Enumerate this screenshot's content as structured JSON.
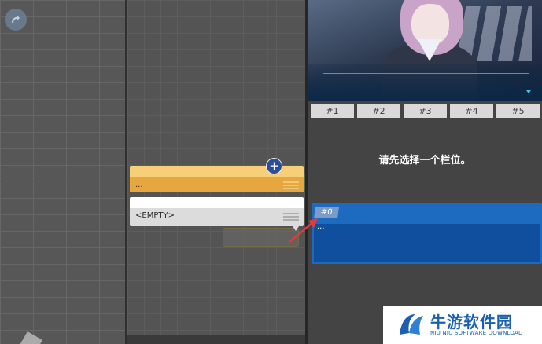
{
  "left_panel": {
    "redo_icon": "redo-arrow-icon"
  },
  "nodes": [
    {
      "text": "...",
      "color": "#e6a73e"
    },
    {
      "text": "<EMPTY>",
      "color": "#dcdcdc"
    }
  ],
  "add_icon": "plus-icon",
  "add_label": "+",
  "preview": {
    "dialog_text": "..."
  },
  "slot_tabs": [
    "#1",
    "#2",
    "#3",
    "#4",
    "#5"
  ],
  "prompt_text": "请先选择一个栏位。",
  "selected_slot": {
    "badge": "#0",
    "text": "..."
  },
  "accent_color": "#1d6bc1",
  "watermark": {
    "title": "牛游软件园",
    "subtitle": "NIU NIU SOFTWARE DOWNLOAD"
  }
}
